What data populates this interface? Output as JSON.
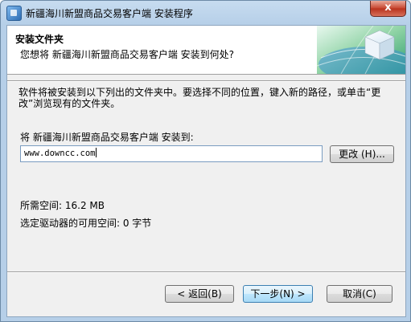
{
  "window": {
    "title": "新疆海川新盟商品交易客户端 安装程序",
    "close_label": "x"
  },
  "header": {
    "title": "安装文件夹",
    "subtitle": "您想将 新疆海川新盟商品交易客户端 安装到何处?"
  },
  "body": {
    "description": "软件将被安装到以下列出的文件夹中。要选择不同的位置，键入新的路径，或单击“更改”浏览现有的文件夹。",
    "install_prompt": "将 新疆海川新盟商品交易客户端 安装到:",
    "install_path": "www.downcc.com",
    "change_button": "更改 (H)...",
    "required_space": "所需空间: 16.2 MB",
    "available_space": "选定驱动器的可用空间: 0 字节"
  },
  "footer": {
    "back_button": "< 返回(B)",
    "next_button": "下一步(N) >",
    "cancel_button": "取消(C)"
  },
  "colors": {
    "window_frame": "#b6cfe8",
    "client_bg": "#f0f0f0",
    "default_button": "#bee6fd",
    "close_button": "#c7452f"
  }
}
